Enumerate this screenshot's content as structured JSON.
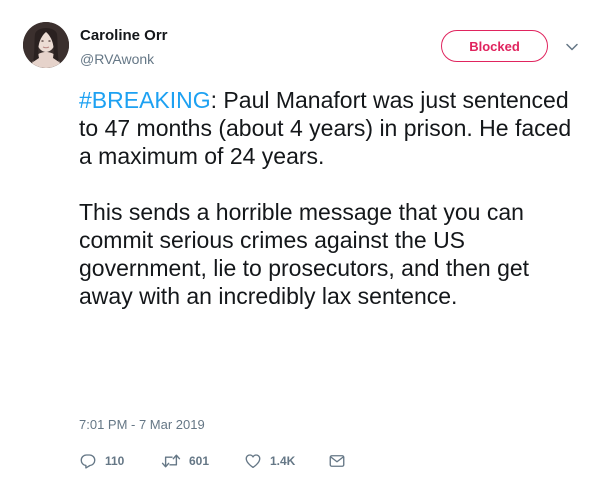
{
  "author": {
    "name": "Caroline Orr",
    "handle": "@RVAwonk"
  },
  "header": {
    "blocked_label": "Blocked"
  },
  "tweet": {
    "hashtag": "#BREAKING",
    "paragraph1_rest": ": Paul Manafort was just sentenced to 47 months (about 4 years) in prison. He faced a maximum of 24 years.",
    "paragraph2": "This sends a horrible message that you can commit serious crimes against the US government, lie to prosecutors, and then get away with an incredibly lax sentence.",
    "timestamp": "7:01 PM - 7 Mar 2019"
  },
  "actions": {
    "reply_count": "110",
    "retweet_count": "601",
    "like_count": "1.4K"
  },
  "colors": {
    "accent": "#1da1f2",
    "blocked": "#e0245e",
    "secondary_text": "#657786",
    "primary_text": "#14171a"
  },
  "icons": [
    "avatar",
    "chevron-down-icon",
    "reply-icon",
    "retweet-icon",
    "like-icon",
    "message-icon"
  ]
}
